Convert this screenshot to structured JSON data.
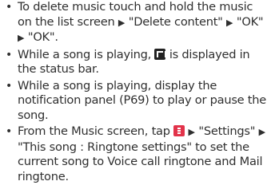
{
  "notes": [
    {
      "bullet": "•",
      "parts": [
        "To delete music touch and hold the music on the list screen ",
        "▶",
        " \"Delete content\" ",
        "▶",
        " \"OK\" ",
        "▶",
        " \"OK\"."
      ]
    },
    {
      "bullet": "•",
      "parts": [
        "While a song is playing, ",
        " is displayed in the status bar."
      ],
      "icon": "music-note-status-icon"
    },
    {
      "bullet": "•",
      "parts": [
        "While a song is playing, display the notification panel (P69) to play or pause the song."
      ]
    },
    {
      "bullet": "•",
      "parts": [
        "From the Music screen, tap ",
        " ",
        "▶",
        " \"Settings\" ",
        "▶",
        " \"This song : Ringtone settings\" to set the current song to Voice call ringtone and Mail ringtone."
      ],
      "icon": "menu-key-icon"
    }
  ],
  "colors": {
    "text": "#2f2f2f",
    "menu_icon": "#e2334a",
    "status_icon": "#222222"
  }
}
